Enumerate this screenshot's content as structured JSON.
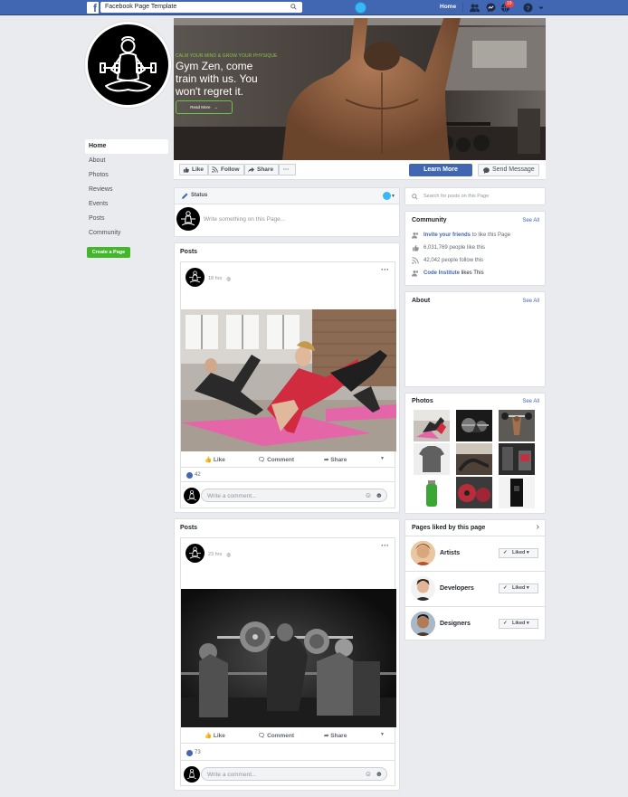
{
  "topbar": {
    "search_value": "Facebook Page Template",
    "home_label": "Home",
    "notification_count": "19"
  },
  "cover": {
    "tagline": "CALM YOUR MIND & GROW YOUR PHYSIQUE",
    "headline": "Gym Zen, come train with us. You won't regret it.",
    "read_more": "Read More"
  },
  "nav": {
    "items": [
      "Home",
      "About",
      "Photos",
      "Reviews",
      "Events",
      "Posts",
      "Community"
    ],
    "create_page": "Create a Page"
  },
  "actions": {
    "like": "Like",
    "follow": "Follow",
    "share": "Share",
    "more": "···",
    "learn_more": "Learn More",
    "send_message": "Send Message"
  },
  "status": {
    "title": "Status",
    "placeholder": "Write something on this Page..."
  },
  "posts_section_title": "Posts",
  "posts": [
    {
      "time": "18 hrs",
      "likes": "42",
      "comment_placeholder": "Write a comment..."
    },
    {
      "time": "23 hrs",
      "likes": "73",
      "comment_placeholder": "Write a comment..."
    }
  ],
  "post_actions": {
    "like": "Like",
    "comment": "Comment",
    "share": "Share"
  },
  "search_page_placeholder": "Search for posts on this Page",
  "community": {
    "title": "Community",
    "see_all": "See All",
    "invite_link": "Invite your friends",
    "invite_rest": " to like this Page",
    "likes": "6,031,769 people like this",
    "follows": "42,042 people follow this",
    "ci_link": "Code Institute",
    "ci_rest": " likes This"
  },
  "about": {
    "title": "About",
    "see_all": "See All"
  },
  "photos": {
    "title": "Photos",
    "see_all": "See All"
  },
  "pages_liked": {
    "title": "Pages liked by this page",
    "liked_label": "Liked",
    "items": [
      {
        "name": "Artists"
      },
      {
        "name": "Developers"
      },
      {
        "name": "Designers"
      }
    ]
  },
  "colors": {
    "brand_blue": "#4267b2",
    "create_green": "#42b72a",
    "accent_green": "#8bc34a",
    "notification_red": "#fa3e3e"
  }
}
